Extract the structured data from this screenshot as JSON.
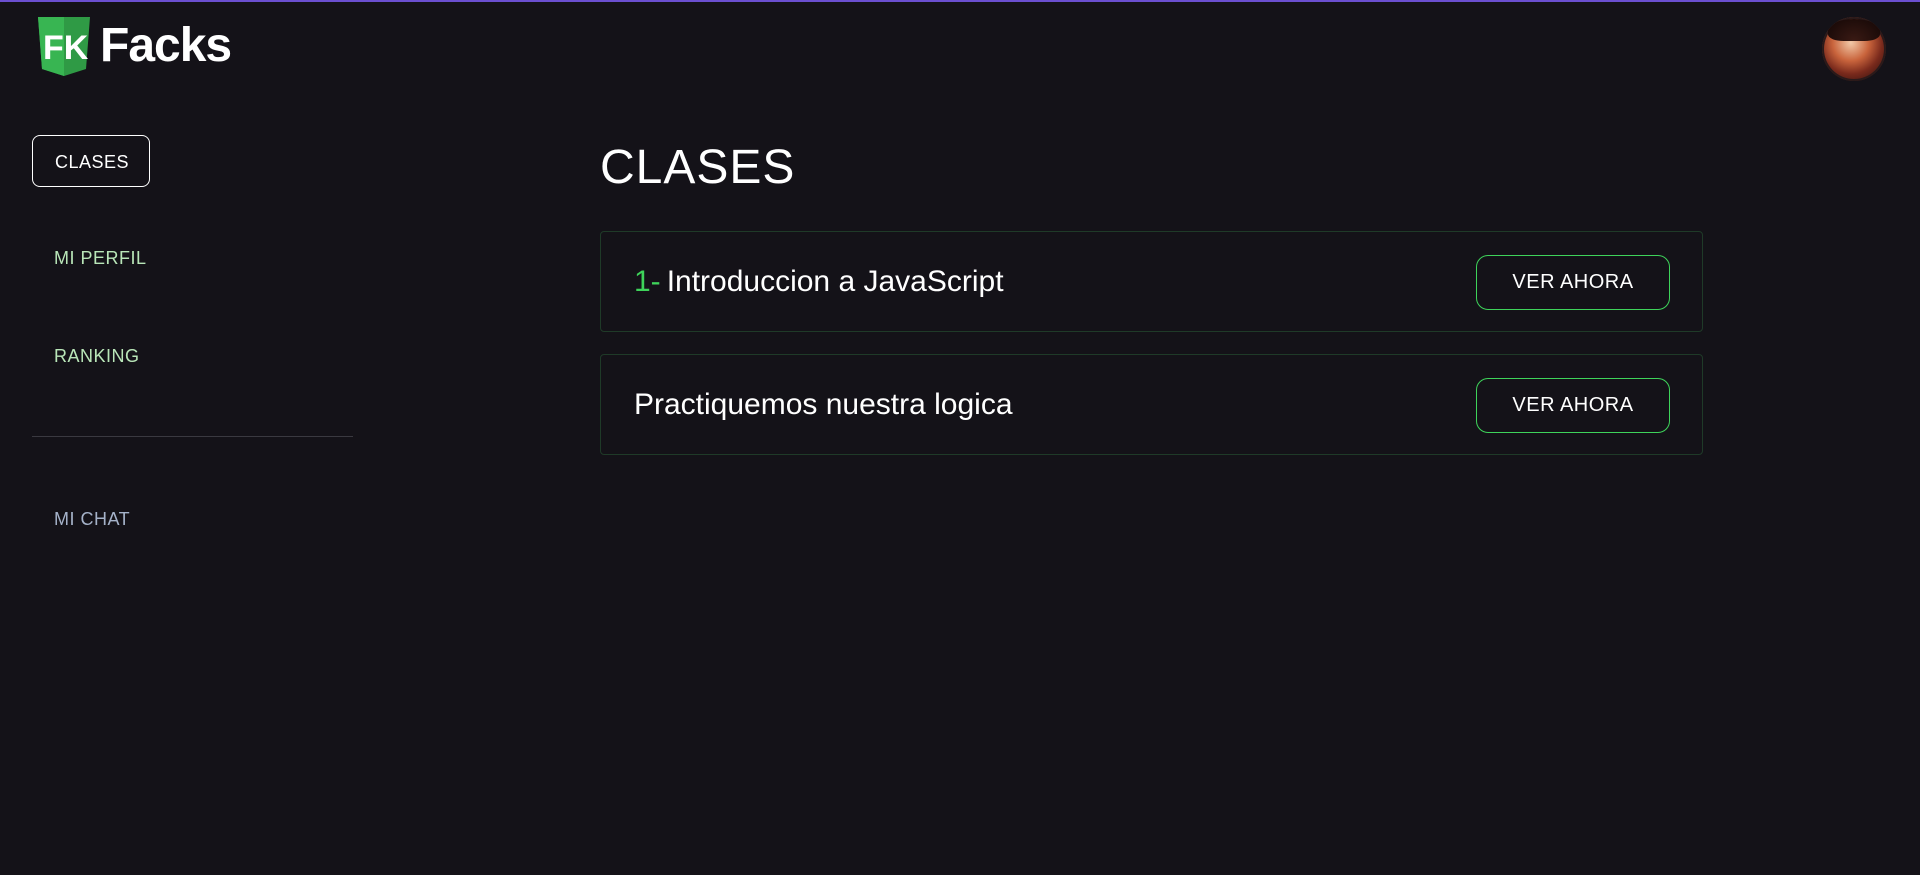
{
  "header": {
    "logo_text": "Facks",
    "logo_mark": "FK",
    "accent_color": "#6b4fd0"
  },
  "sidebar": {
    "items": [
      {
        "label": "CLASES",
        "active": true
      },
      {
        "label": "MI PERFIL",
        "active": false
      },
      {
        "label": "RANKING",
        "active": false
      },
      {
        "label": "MI CHAT",
        "active": false
      }
    ]
  },
  "main": {
    "title": "CLASES",
    "cards": [
      {
        "number": "1-",
        "title": "Introduccion a JavaScript",
        "button": "VER AHORA"
      },
      {
        "number": "",
        "title": "Practiquemos nuestra logica",
        "button": "VER AHORA"
      }
    ]
  },
  "colors": {
    "background": "#141218",
    "green": "#3ed35a",
    "nav_green": "#b9e6b8",
    "nav_muted": "#a5b2c9"
  }
}
